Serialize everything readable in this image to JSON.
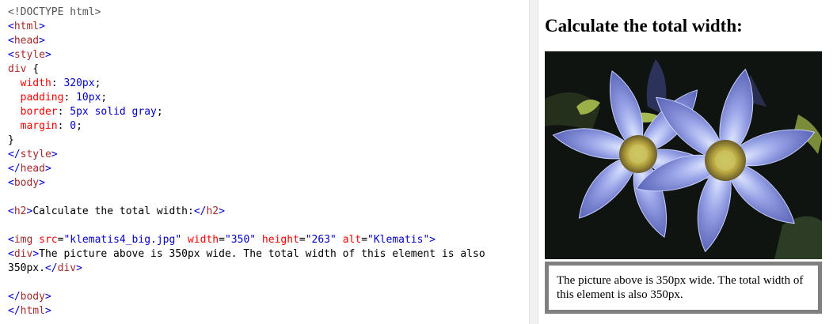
{
  "code_lines": [
    [
      {
        "t": "<!DOCTYPE html>",
        "c": "doctype"
      }
    ],
    [
      {
        "t": "<",
        "c": "br"
      },
      {
        "t": "html",
        "c": "tag"
      },
      {
        "t": ">",
        "c": "br"
      }
    ],
    [
      {
        "t": "<",
        "c": "br"
      },
      {
        "t": "head",
        "c": "tag"
      },
      {
        "t": ">",
        "c": "br"
      }
    ],
    [
      {
        "t": "<",
        "c": "br"
      },
      {
        "t": "style",
        "c": "tag"
      },
      {
        "t": ">",
        "c": "br"
      }
    ],
    [
      {
        "t": "div",
        "c": "sel"
      },
      {
        "t": " {",
        "c": "punct"
      }
    ],
    [
      {
        "t": "  ",
        "c": "punct"
      },
      {
        "t": "width",
        "c": "prop"
      },
      {
        "t": ": ",
        "c": "punct"
      },
      {
        "t": "320px",
        "c": "val"
      },
      {
        "t": ";",
        "c": "punct"
      }
    ],
    [
      {
        "t": "  ",
        "c": "punct"
      },
      {
        "t": "padding",
        "c": "prop"
      },
      {
        "t": ": ",
        "c": "punct"
      },
      {
        "t": "10px",
        "c": "val"
      },
      {
        "t": ";",
        "c": "punct"
      }
    ],
    [
      {
        "t": "  ",
        "c": "punct"
      },
      {
        "t": "border",
        "c": "prop"
      },
      {
        "t": ": ",
        "c": "punct"
      },
      {
        "t": "5px solid gray",
        "c": "val"
      },
      {
        "t": ";",
        "c": "punct"
      }
    ],
    [
      {
        "t": "  ",
        "c": "punct"
      },
      {
        "t": "margin",
        "c": "prop"
      },
      {
        "t": ": ",
        "c": "punct"
      },
      {
        "t": "0",
        "c": "val"
      },
      {
        "t": ";",
        "c": "punct"
      }
    ],
    [
      {
        "t": "}",
        "c": "punct"
      }
    ],
    [
      {
        "t": "</",
        "c": "br"
      },
      {
        "t": "style",
        "c": "tag"
      },
      {
        "t": ">",
        "c": "br"
      }
    ],
    [
      {
        "t": "</",
        "c": "br"
      },
      {
        "t": "head",
        "c": "tag"
      },
      {
        "t": ">",
        "c": "br"
      }
    ],
    [
      {
        "t": "<",
        "c": "br"
      },
      {
        "t": "body",
        "c": "tag"
      },
      {
        "t": ">",
        "c": "br"
      }
    ],
    [],
    [
      {
        "t": "<",
        "c": "br"
      },
      {
        "t": "h2",
        "c": "tag"
      },
      {
        "t": ">",
        "c": "br"
      },
      {
        "t": "Calculate the total width:",
        "c": "text"
      },
      {
        "t": "</",
        "c": "br"
      },
      {
        "t": "h2",
        "c": "tag"
      },
      {
        "t": ">",
        "c": "br"
      }
    ],
    [],
    [
      {
        "t": "<",
        "c": "br"
      },
      {
        "t": "img",
        "c": "tag"
      },
      {
        "t": " src",
        "c": "attr"
      },
      {
        "t": "=",
        "c": "punct"
      },
      {
        "t": "\"klematis4_big.jpg\"",
        "c": "str"
      },
      {
        "t": " width",
        "c": "attr"
      },
      {
        "t": "=",
        "c": "punct"
      },
      {
        "t": "\"350\"",
        "c": "str"
      },
      {
        "t": " height",
        "c": "attr"
      },
      {
        "t": "=",
        "c": "punct"
      },
      {
        "t": "\"263\"",
        "c": "str"
      },
      {
        "t": " alt",
        "c": "attr"
      },
      {
        "t": "=",
        "c": "punct"
      },
      {
        "t": "\"Klematis\"",
        "c": "str"
      },
      {
        "t": ">",
        "c": "br"
      }
    ],
    [
      {
        "t": "<",
        "c": "br"
      },
      {
        "t": "div",
        "c": "tag"
      },
      {
        "t": ">",
        "c": "br"
      },
      {
        "t": "The picture above is 350px wide. The total width of this element is also",
        "c": "text"
      }
    ],
    [
      {
        "t": "350px.",
        "c": "text"
      },
      {
        "t": "</",
        "c": "br"
      },
      {
        "t": "div",
        "c": "tag"
      },
      {
        "t": ">",
        "c": "br"
      }
    ],
    [],
    [
      {
        "t": "</",
        "c": "br"
      },
      {
        "t": "body",
        "c": "tag"
      },
      {
        "t": ">",
        "c": "br"
      }
    ],
    [
      {
        "t": "</",
        "c": "br"
      },
      {
        "t": "html",
        "c": "tag"
      },
      {
        "t": ">",
        "c": "br"
      }
    ]
  ],
  "result": {
    "heading": "Calculate the total width:",
    "image_alt": "Klematis",
    "text": "The picture above is 350px wide. The total width of this element is also 350px."
  }
}
